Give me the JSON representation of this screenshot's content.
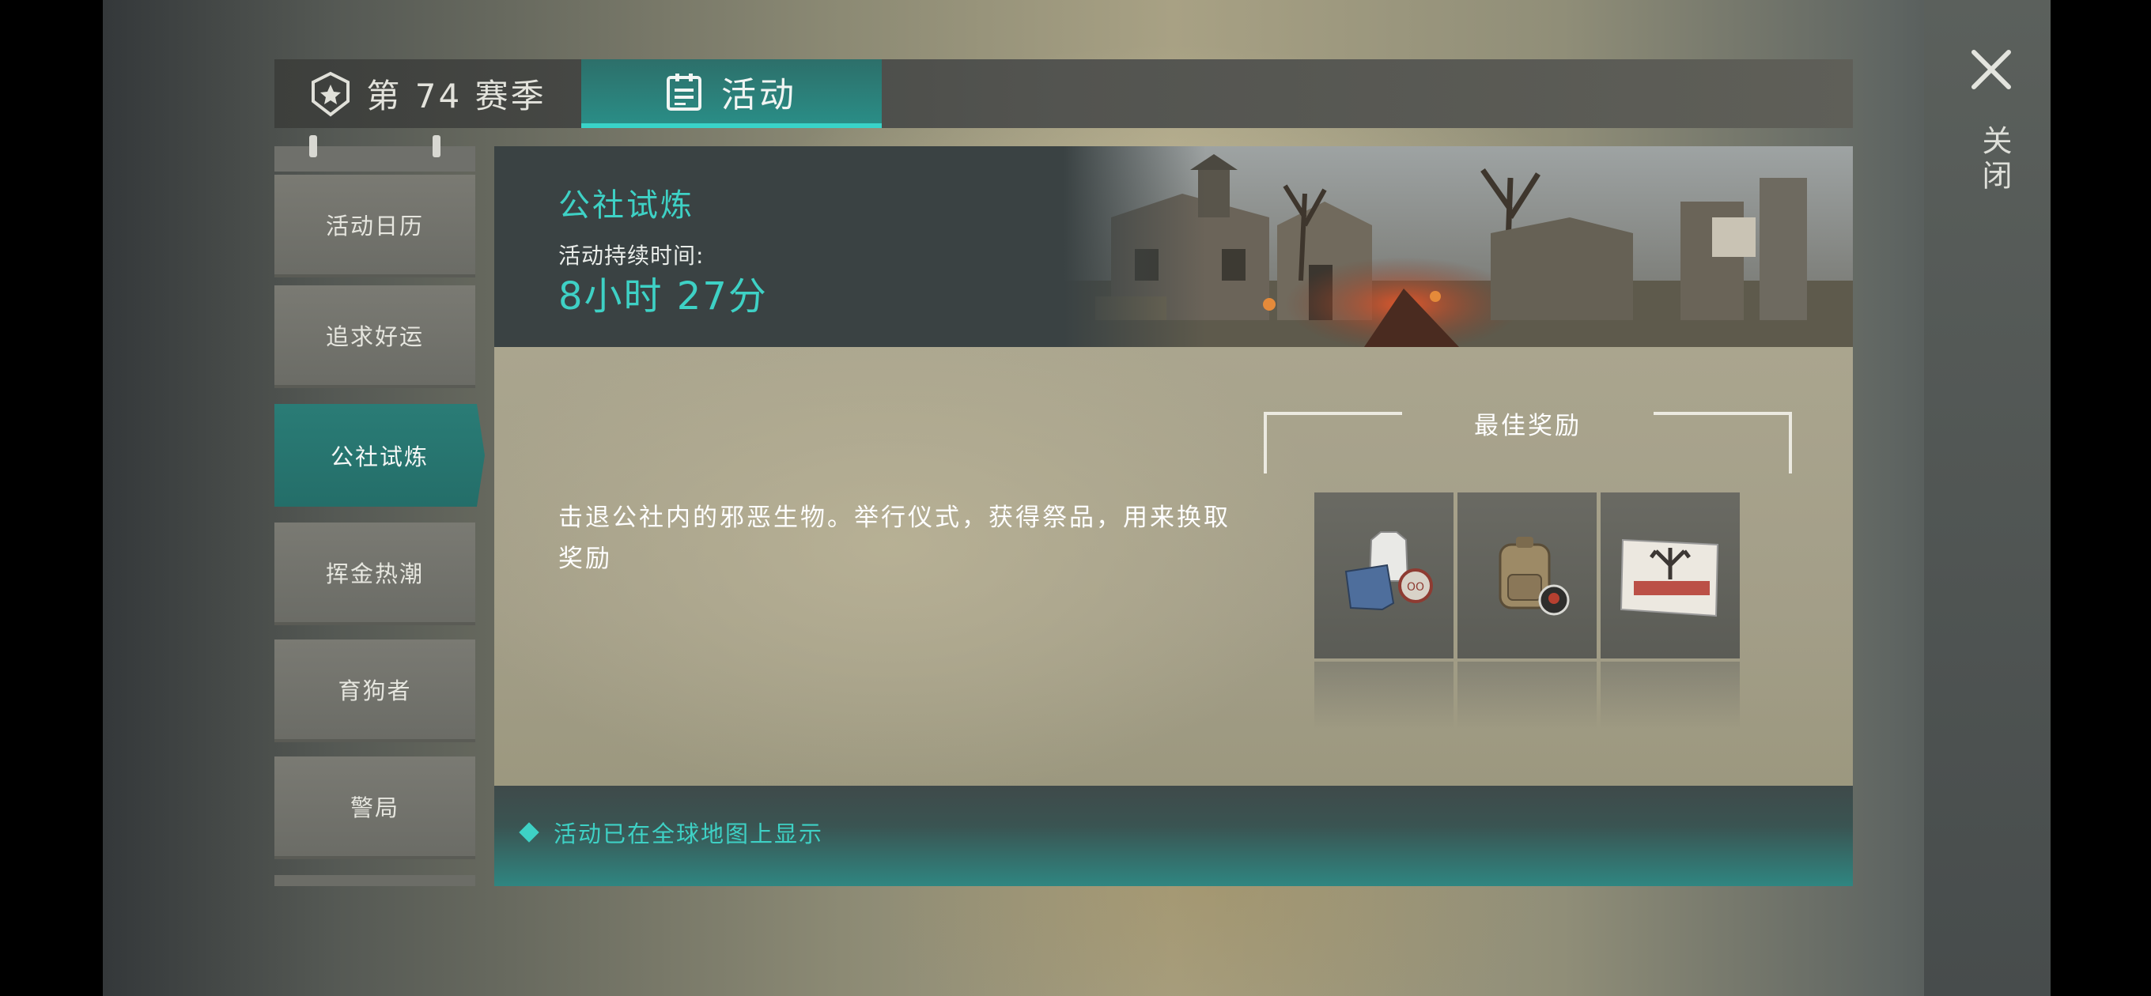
{
  "tabs": {
    "season": {
      "label": "第 74 赛季",
      "icon": "season-badge-icon"
    },
    "events": {
      "label": "活动",
      "icon": "calendar-icon",
      "active": true
    }
  },
  "sidebar": {
    "items": [
      {
        "label": "活动日历",
        "active": false
      },
      {
        "label": "追求好运",
        "active": false
      },
      {
        "label": "公社试炼",
        "active": true
      },
      {
        "label": "挥金热潮",
        "active": false
      },
      {
        "label": "育狗者",
        "active": false
      },
      {
        "label": "警局",
        "active": false
      }
    ]
  },
  "event": {
    "title": "公社试炼",
    "duration_label": "活动持续时间:",
    "duration_value": "8小时 27分",
    "description": "击退公社内的邪恶生物。举行仪式，获得祭品，用来换取奖励"
  },
  "rewards": {
    "title": "最佳奖励",
    "items": [
      {
        "icon": "clothing-set-icon"
      },
      {
        "icon": "backpack-icon"
      },
      {
        "icon": "banner-flag-icon"
      }
    ]
  },
  "footer": {
    "text": "活动已在全球地图上显示"
  },
  "close": {
    "label": "关闭"
  },
  "colors": {
    "accent": "#3ed1c5",
    "active_tab": "#2a8d86"
  }
}
